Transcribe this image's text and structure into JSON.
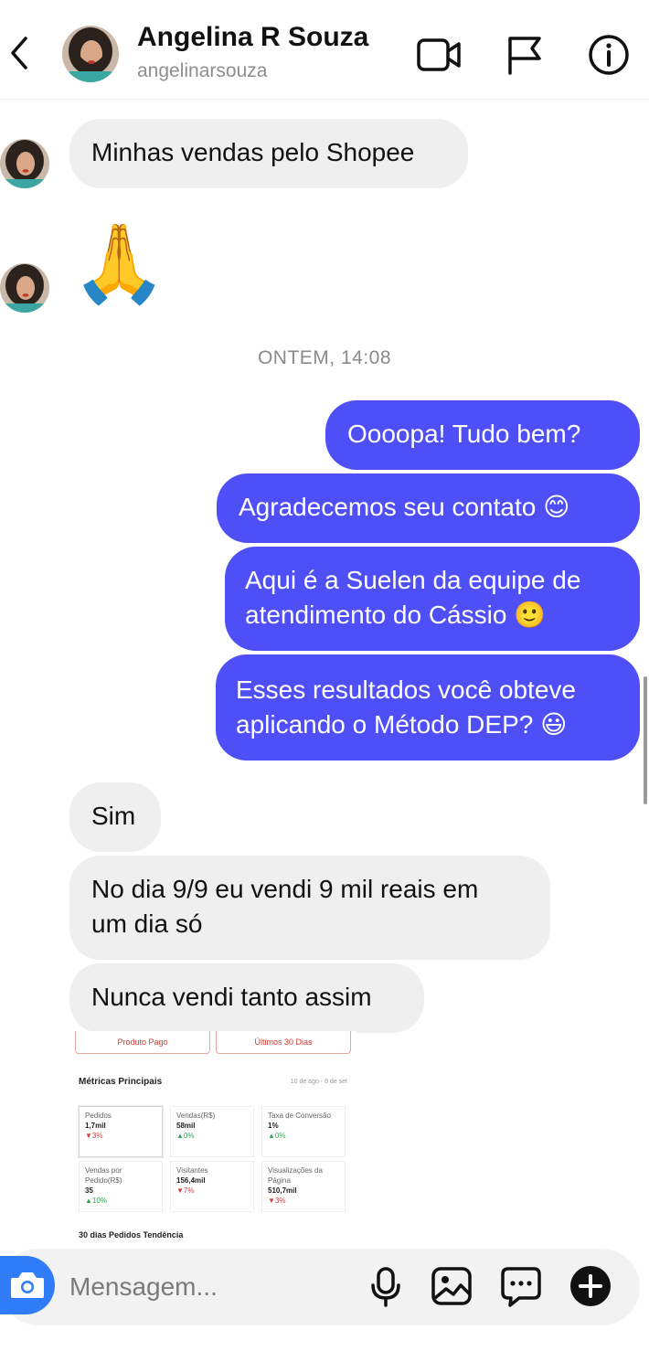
{
  "header": {
    "name": "Angelina R Souza",
    "username": "angelinarsouza"
  },
  "messages": {
    "m1": "Minhas vendas pelo Shopee",
    "m2_emoji": "🙏",
    "timestamp": "ONTEM, 14:08",
    "o1": "Oooopa! Tudo bem?",
    "o2": "Agradecemos seu contato 😊",
    "o3_l1": "Aqui é a Suelen da equipe de",
    "o3_l2": "atendimento do Cássio 🙂",
    "o4_l1": "Esses resultados você obteve",
    "o4_l2": "aplicando o Método DEP? 😃",
    "i1": "Sim",
    "i2_l1": "No dia 9/9 eu vendi 9 mil reais em",
    "i2_l2": "um dia só",
    "i3": "Nunca vendi tanto assim"
  },
  "shared_image": {
    "select_left": "Produto Pago",
    "select_right": "Últimos 30 Dias",
    "title": "Métricas Principais",
    "date_range": "10 de ago - 8 de set",
    "cells": [
      {
        "label": "Pedidos",
        "value": "1,7mil",
        "change": "▼3%"
      },
      {
        "label": "Vendas(R$)",
        "value": "58mil",
        "change": "▲0%"
      },
      {
        "label": "Taxa de Conversão",
        "value": "1%",
        "change": "▲0%"
      },
      {
        "label": "Vendas por Pedido(R$)",
        "value": "35",
        "change": "▲10%"
      },
      {
        "label": "Visitantes",
        "value": "156,4mil",
        "change": "▼7%"
      },
      {
        "label": "Visualizações da Página",
        "value": "510,7mil",
        "change": "▼3%"
      }
    ],
    "footer": "30 dias Pedidos Tendência"
  },
  "composer": {
    "placeholder": "Mensagem..."
  },
  "colors": {
    "outgoing": "#4e4ff7",
    "incoming": "#efefef",
    "camera": "#2f7cf6"
  }
}
